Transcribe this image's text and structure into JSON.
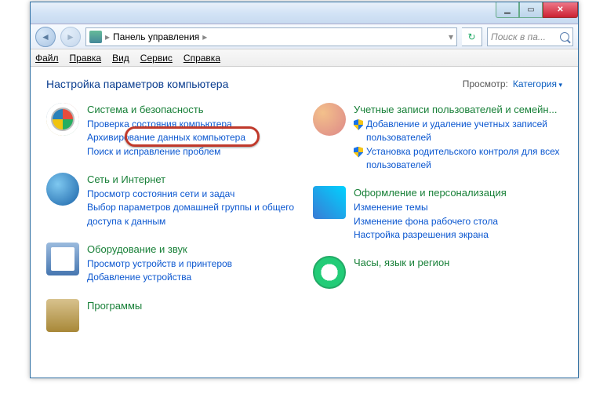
{
  "titlebar": {},
  "nav": {
    "breadcrumb_root": "Панель управления",
    "search_placeholder": "Поиск в пa..."
  },
  "menu": {
    "file": "Файл",
    "edit": "Правка",
    "view": "Вид",
    "tools": "Сервис",
    "help": "Справка"
  },
  "header": {
    "title": "Настройка параметров компьютера",
    "view_label": "Просмотр:",
    "view_value": "Категория"
  },
  "categories": {
    "security": {
      "title": "Система и безопасность",
      "links": [
        "Проверка состояния компьютера",
        "Архивирование данных компьютера",
        "Поиск и исправление проблем"
      ]
    },
    "network": {
      "title": "Сеть и Интернет",
      "links": [
        "Просмотр состояния сети и задач",
        "Выбор параметров домашней группы и общего доступа к данным"
      ]
    },
    "hardware": {
      "title": "Оборудование и звук",
      "links": [
        "Просмотр устройств и принтеров",
        "Добавление устройства"
      ]
    },
    "programs": {
      "title": "Программы"
    },
    "users": {
      "title": "Учетные записи пользователей и семейн...",
      "shielded": [
        "Добавление и удаление учетных записей пользователей",
        "Установка родительского контроля для всех пользователей"
      ]
    },
    "appearance": {
      "title": "Оформление и персонализация",
      "links": [
        "Изменение темы",
        "Изменение фона рабочего стола",
        "Настройка разрешения экрана"
      ]
    },
    "clock": {
      "title": "Часы, язык и регион"
    }
  }
}
